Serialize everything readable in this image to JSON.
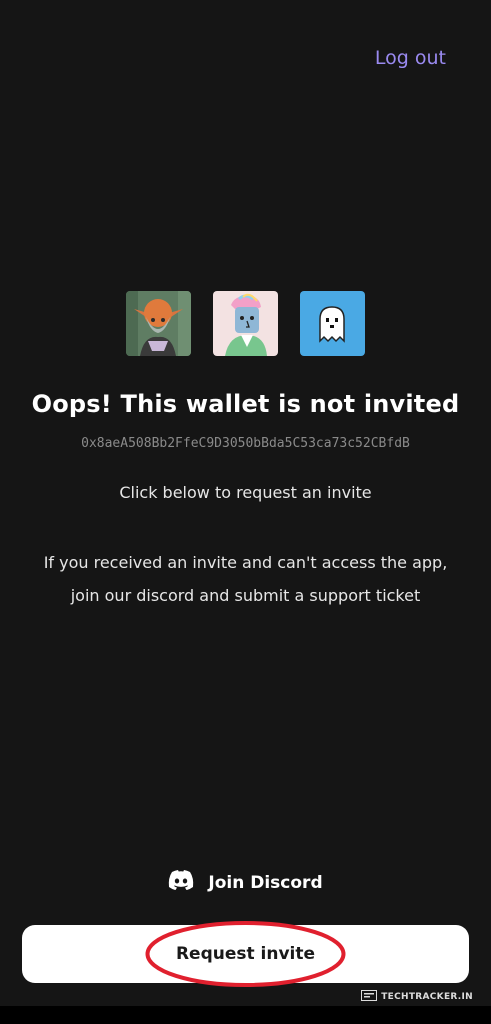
{
  "header": {
    "logout_label": "Log out"
  },
  "avatars": [
    {
      "name": "elf-nft-avatar"
    },
    {
      "name": "punk-nft-avatar"
    },
    {
      "name": "ghost-nft-avatar"
    }
  ],
  "main": {
    "title": "Oops! This wallet is not invited",
    "wallet_address": "0x8aeA508Bb2FfeC9D3050bBda5C53ca73c52CBfdB",
    "click_text": "Click below to request an invite",
    "support_line1": "If you received an invite and can't access the app,",
    "support_line2": "join our discord and submit a support ticket"
  },
  "actions": {
    "discord_label": "Join Discord",
    "discord_icon": "discord-icon",
    "request_label": "Request invite"
  },
  "watermark": {
    "text": "TECHTRACKER.IN"
  },
  "colors": {
    "background": "#151515",
    "accent": "#9a8af0",
    "annotation": "#e0202e"
  }
}
